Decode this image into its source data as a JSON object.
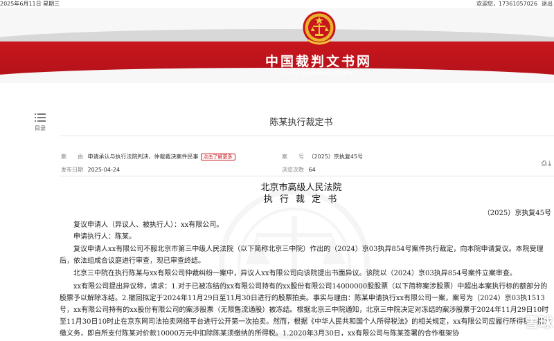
{
  "topbar": {
    "date": "2025年6月11日 星期三",
    "welcome": "欢迎您，17361057026",
    "logout": "退出"
  },
  "header": {
    "site_title": "中国裁判文书网",
    "site_subtitle": "China Judgements Online"
  },
  "toc": {
    "label": "目录"
  },
  "document": {
    "title": "陈某执行裁定书",
    "cause_label": "案　　由",
    "cause_value": "申请承认与执行法院判决、仲裁裁决案件民事",
    "more_label": "点击了解更多",
    "caseno_label": "案　　号",
    "caseno_value": "（2025）京执复45号",
    "date_label": "发布日期",
    "date_value": "2025-04-24",
    "views_label": "浏览次数",
    "views_value": "64",
    "court": "北京市高级人民法院",
    "doc_type": "执 行 裁 定 书",
    "case_number": "（2025）京执复45号",
    "paragraphs": [
      "复议申请人（异议人、被执行人）：xx有限公司。",
      "申请执行人：陈某。",
      "复议申请人xx有限公司不服北京市第三中级人民法院（以下简称北京三中院）作出的（2024）京03执异854号案件执行裁定，向本院申请复议。本院受理后，依法组成合议庭进行审查，现已审查终结。",
      "北京三中院在执行陈某与xx有限公司仲裁纠纷一案中，异议人xx有限公司向该院提出书面异议。该院以（2024）京03执异854号案件立案审查。",
      "xx有限公司提出异议称，请求：1.对于已被冻结的xx有限公司持有的xx股份有限公司14000000股股票（以下简称案涉股票）中超出本案执行标的额部分的股票予以解除冻结。2.撤回拟定于2024年11月29日至11月30日进行的股票拍卖。事实与理由：陈某申请执行xx有限公司一案，案号为（2024）京03执1513号，xx有限公司持有的xx股份有限公司的案涉股票（无限售流通股）被冻结。根据北京三中院通知，北京三中院决定对冻结的案涉股票于2024年11月29日10时至11月30日10时止在京东网司法拍卖网络平台进行公开第一次拍卖。然而，根据《中华人民共和国个人所得税法》的相关规定，xx有限公司应履行所得税代扣代缴义务，即自所支付陈某对价款10000万元中扣除陈某须缴纳的所得税。1.2020年3月30日，xx有限公司与陈某签署的合作框架协"
    ]
  },
  "tools": {
    "print_icon": "print-icon",
    "download_icon": "download-icon"
  },
  "watermark_text": "雪球"
}
